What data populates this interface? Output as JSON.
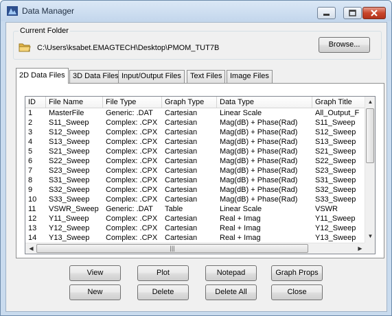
{
  "window": {
    "title": "Data Manager"
  },
  "folder": {
    "label": "Current Folder",
    "path": "C:\\Users\\ksabet.EMAGTECH\\Desktop\\PMOM_TUT7B",
    "browse_label": "Browse..."
  },
  "tabs": [
    "2D Data Files",
    "3D Data Files",
    "Input/Output Files",
    "Text Files",
    "Image Files"
  ],
  "table": {
    "columns": [
      "ID",
      "File Name",
      "File Type",
      "Graph Type",
      "Data Type",
      "Graph Title"
    ],
    "rows": [
      [
        "1",
        "MasterFile",
        "Generic: .DAT",
        "Cartesian",
        "Linear Scale",
        "All_Output_F"
      ],
      [
        "2",
        "S11_Sweep",
        "Complex: .CPX",
        "Cartesian",
        "Mag(dB) + Phase(Rad)",
        "S11_Sweep"
      ],
      [
        "3",
        "S12_Sweep",
        "Complex: .CPX",
        "Cartesian",
        "Mag(dB) + Phase(Rad)",
        "S12_Sweep"
      ],
      [
        "4",
        "S13_Sweep",
        "Complex: .CPX",
        "Cartesian",
        "Mag(dB) + Phase(Rad)",
        "S13_Sweep"
      ],
      [
        "5",
        "S21_Sweep",
        "Complex: .CPX",
        "Cartesian",
        "Mag(dB) + Phase(Rad)",
        "S21_Sweep"
      ],
      [
        "6",
        "S22_Sweep",
        "Complex: .CPX",
        "Cartesian",
        "Mag(dB) + Phase(Rad)",
        "S22_Sweep"
      ],
      [
        "7",
        "S23_Sweep",
        "Complex: .CPX",
        "Cartesian",
        "Mag(dB) + Phase(Rad)",
        "S23_Sweep"
      ],
      [
        "8",
        "S31_Sweep",
        "Complex: .CPX",
        "Cartesian",
        "Mag(dB) + Phase(Rad)",
        "S31_Sweep"
      ],
      [
        "9",
        "S32_Sweep",
        "Complex: .CPX",
        "Cartesian",
        "Mag(dB) + Phase(Rad)",
        "S32_Sweep"
      ],
      [
        "10",
        "S33_Sweep",
        "Complex: .CPX",
        "Cartesian",
        "Mag(dB) + Phase(Rad)",
        "S33_Sweep"
      ],
      [
        "11",
        "VSWR_Sweep",
        "Generic: .DAT",
        "Table",
        "Linear Scale",
        "VSWR"
      ],
      [
        "12",
        "Y11_Sweep",
        "Complex: .CPX",
        "Cartesian",
        "Real + Imag",
        "Y11_Sweep"
      ],
      [
        "13",
        "Y12_Sweep",
        "Complex: .CPX",
        "Cartesian",
        "Real + Imag",
        "Y12_Sweep"
      ],
      [
        "14",
        "Y13_Sweep",
        "Complex: .CPX",
        "Cartesian",
        "Real + Imag",
        "Y13_Sweep"
      ]
    ]
  },
  "buttons": {
    "view": "View",
    "plot": "Plot",
    "notepad": "Notepad",
    "graph_props": "Graph Props",
    "new": "New",
    "delete": "Delete",
    "delete_all": "Delete All",
    "close": "Close"
  },
  "icons": {
    "app": "app-icon",
    "folder": "folder-icon"
  },
  "colors": {
    "titlebar": "#c3d6ec",
    "close_button": "#c9452b",
    "client_bg": "#f0f0f0"
  }
}
